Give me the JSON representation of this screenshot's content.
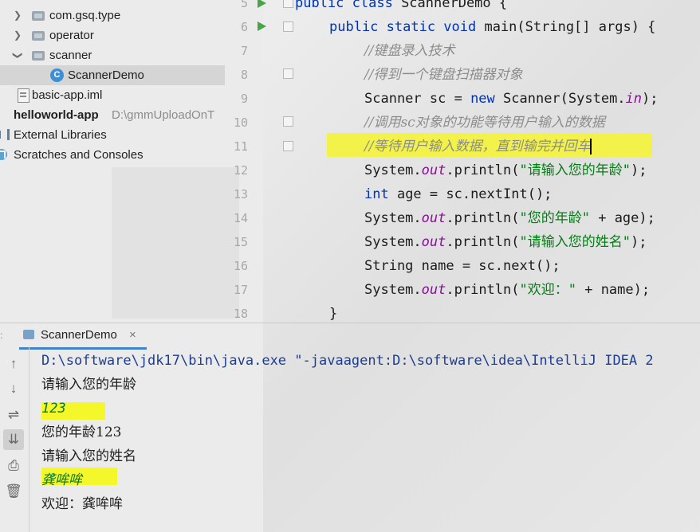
{
  "project_tree": {
    "items": [
      {
        "label": "com.gsq.type"
      },
      {
        "label": "operator"
      },
      {
        "label": "scanner"
      },
      {
        "label": "ScannerDemo"
      },
      {
        "label": "basic-app.iml"
      },
      {
        "label": "helloworld-app",
        "path": "D:\\gmmUploadOnT"
      },
      {
        "label": "External Libraries"
      },
      {
        "label": "Scratches and Consoles"
      }
    ]
  },
  "editor": {
    "line_numbers": [
      "5",
      "6",
      "7",
      "8",
      "9",
      "10",
      "11",
      "12",
      "13",
      "14",
      "15",
      "16",
      "17",
      "18"
    ],
    "lines": {
      "l5": {
        "kw": "public class ",
        "rest": "ScannerDemo {"
      },
      "l6": {
        "kw": "public static void ",
        "rest": "main(String[] args) {"
      },
      "l7": "//键盘录入技术",
      "l8": "//得到一个键盘扫描器对象",
      "l9": {
        "a": "Scanner sc = ",
        "kw": "new",
        "b": " Scanner(System.",
        "fld": "in",
        "c": ");"
      },
      "l10": "//调用sc对象的功能等待用户输入的数据",
      "l11": "//等待用户输入数据，直到输完并回车",
      "l12": {
        "a": "System.",
        "fld": "out",
        "b": ".println(",
        "st": "\"请输入您的年龄\"",
        "c": ");"
      },
      "l13": {
        "kw": "int",
        "rest": " age = sc.nextInt();"
      },
      "l14": {
        "a": "System.",
        "fld": "out",
        "b": ".println(",
        "st": "\"您的年龄\"",
        "c": " + age);"
      },
      "l15": {
        "a": "System.",
        "fld": "out",
        "b": ".println(",
        "st": "\"请输入您的姓名\"",
        "c": ");"
      },
      "l16": "String name = sc.next();",
      "l17": {
        "a": "System.",
        "fld": "out",
        "b": ".println(",
        "st": "\"欢迎：\"",
        "c": " + name);"
      },
      "l18": "}"
    }
  },
  "run_panel": {
    "tab_label": "ScannerDemo",
    "tab_close": "×",
    "console_lines": [
      "D:\\software\\jdk17\\bin\\java.exe \"-javaagent:D:\\software\\idea\\IntelliJ IDEA 2",
      "请输入您的年龄",
      "123",
      "您的年龄123",
      "请输入您的姓名",
      "龚哞哞",
      "欢迎：龚哞哞"
    ]
  },
  "colors": {
    "keyword": "#0033b3",
    "comment": "#8c8c8c",
    "string": "#067d17",
    "field": "#871094",
    "highlight": "#f4f72a",
    "run_icon": "#46a546",
    "user_input": "#0a7a2d"
  },
  "icons": [
    "chevron-right-icon",
    "chevron-down-icon",
    "package-folder-icon",
    "java-class-icon",
    "module-file-icon",
    "library-icon",
    "scratches-icon",
    "run-gutter-icon",
    "up-arrow-icon",
    "down-arrow-icon",
    "soft-wrap-icon",
    "scroll-to-end-icon",
    "print-icon",
    "trash-icon"
  ]
}
